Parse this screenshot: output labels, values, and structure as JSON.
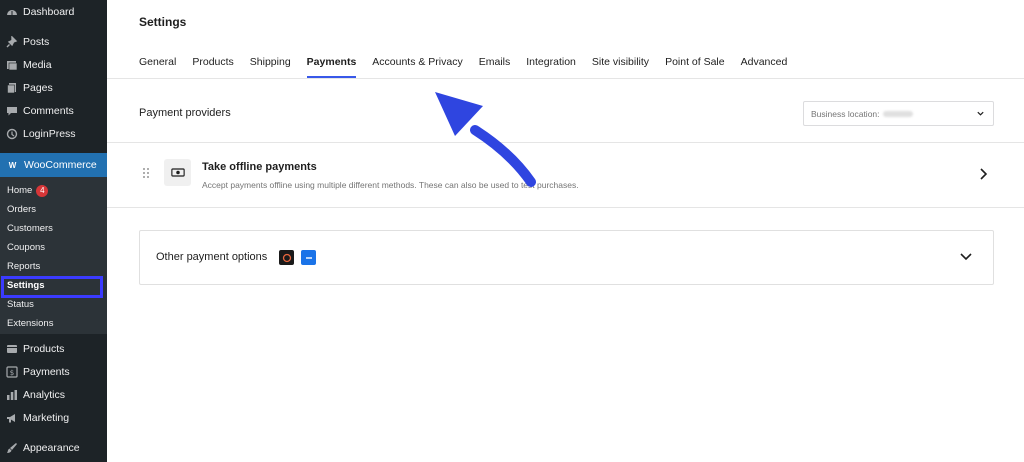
{
  "sidebar": {
    "top_items": [
      {
        "label": "Dashboard",
        "icon": "dashboard-icon"
      },
      {
        "label": "Posts",
        "icon": "pin-icon"
      },
      {
        "label": "Media",
        "icon": "media-icon"
      },
      {
        "label": "Pages",
        "icon": "pages-icon"
      },
      {
        "label": "Comments",
        "icon": "comment-icon"
      },
      {
        "label": "LoginPress",
        "icon": "loginpress-icon"
      }
    ],
    "woocommerce": {
      "label": "WooCommerce",
      "icon_text": "W"
    },
    "sub_items": [
      {
        "label": "Home",
        "badge": "4"
      },
      {
        "label": "Orders"
      },
      {
        "label": "Customers"
      },
      {
        "label": "Coupons"
      },
      {
        "label": "Reports"
      },
      {
        "label": "Settings"
      },
      {
        "label": "Status"
      },
      {
        "label": "Extensions"
      }
    ],
    "bottom_items": [
      {
        "label": "Products",
        "icon": "products-icon"
      },
      {
        "label": "Payments",
        "icon": "dollar-icon"
      },
      {
        "label": "Analytics",
        "icon": "analytics-icon"
      },
      {
        "label": "Marketing",
        "icon": "megaphone-icon"
      },
      {
        "label": "Appearance",
        "icon": "brush-icon"
      }
    ]
  },
  "header": {
    "title": "Settings"
  },
  "tabs": [
    {
      "label": "General"
    },
    {
      "label": "Products"
    },
    {
      "label": "Shipping"
    },
    {
      "label": "Payments",
      "active": true
    },
    {
      "label": "Accounts & Privacy"
    },
    {
      "label": "Emails"
    },
    {
      "label": "Integration"
    },
    {
      "label": "Site visibility"
    },
    {
      "label": "Point of Sale"
    },
    {
      "label": "Advanced"
    }
  ],
  "providers": {
    "title": "Payment providers",
    "location_label": "Business location:"
  },
  "offline": {
    "title": "Take offline payments",
    "description": "Accept payments offline using multiple different methods. These can also be used to test purchases."
  },
  "other": {
    "title": "Other payment options"
  },
  "colors": {
    "sidebar_bg": "#1d2327",
    "woo_blue": "#2271b1",
    "accent": "#3858e9",
    "highlight": "#3b3bff"
  }
}
